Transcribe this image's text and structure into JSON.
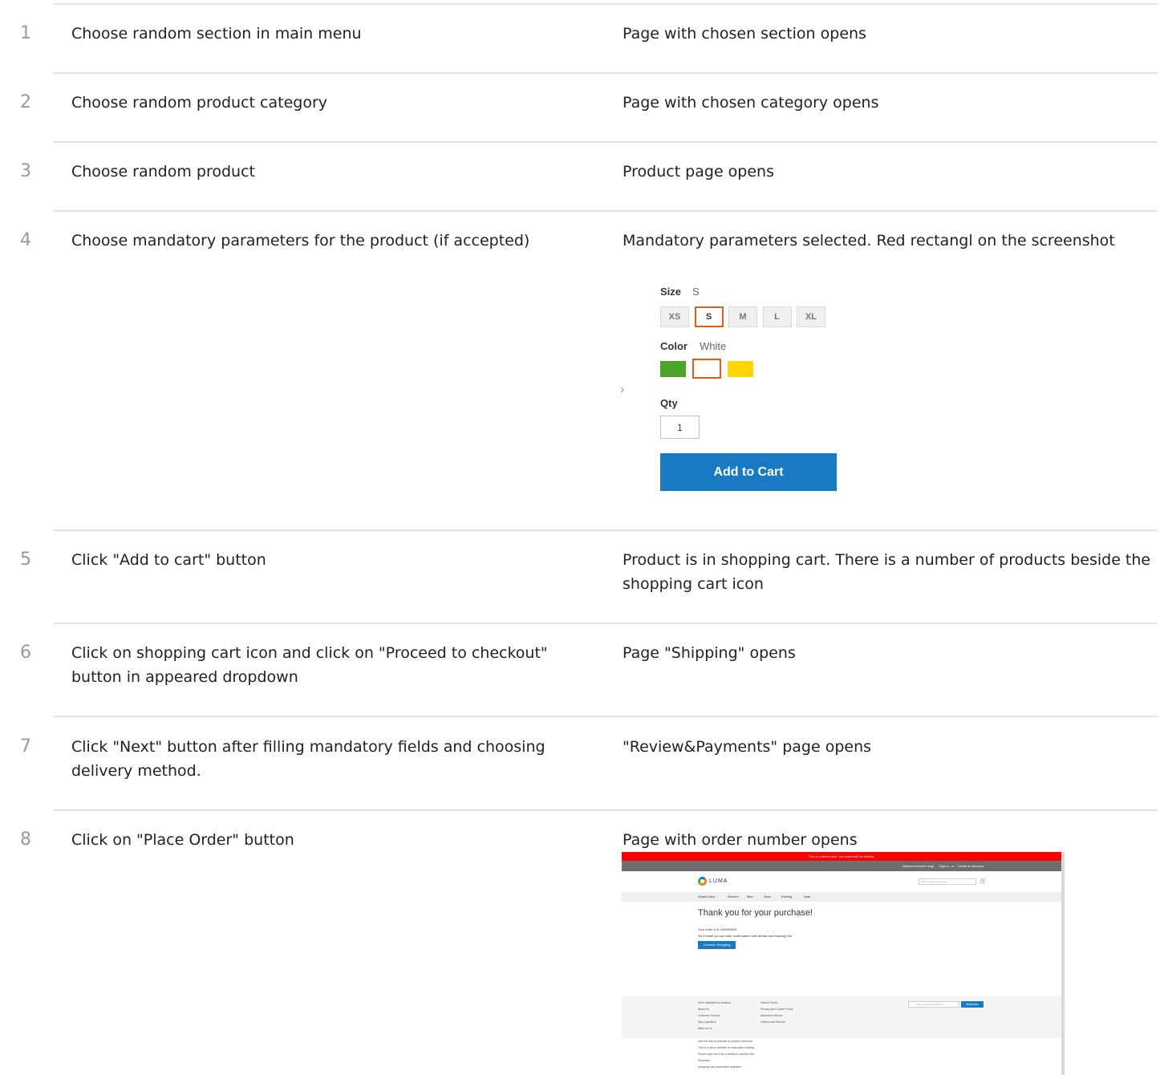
{
  "steps": [
    {
      "num": "1",
      "action": "Choose random section in main menu",
      "result": "Page with chosen section opens"
    },
    {
      "num": "2",
      "action": "Choose random product category",
      "result": "Page with chosen category opens"
    },
    {
      "num": "3",
      "action": "Choose random product",
      "result": "Product page opens"
    },
    {
      "num": "4",
      "action": "Choose mandatory parameters for the product (if accepted)",
      "result": "Mandatory parameters selected. Red rectangl on the screenshot"
    },
    {
      "num": "5",
      "action": "Click \"Add to cart\" button",
      "result": "Product is in shopping cart. There is a number of products beside the shopping cart icon"
    },
    {
      "num": "6",
      "action": "Click on shopping cart icon and click on \"Proceed to checkout\" button in appeared dropdown",
      "result": "Page \"Shipping\" opens"
    },
    {
      "num": "7",
      "action": "Click \"Next\" button after filling mandatory fields and choosing delivery method.",
      "result": "\"Review&Payments\" page opens"
    },
    {
      "num": "8",
      "action": "Click on \"Place Order\" button",
      "result": "Page with order number opens"
    }
  ],
  "product_options": {
    "size_label": "Size",
    "size_value": "S",
    "sizes": [
      "XS",
      "S",
      "M",
      "L",
      "XL"
    ],
    "selected_size": "S",
    "color_label": "Color",
    "color_value": "White",
    "colors": [
      "#4ca52a",
      "#ffffff",
      "#ffd500"
    ],
    "qty_label": "Qty",
    "qty_value": "1",
    "add_to_cart": "Add to Cart",
    "highlight_color": "#e55a1b"
  },
  "order_page": {
    "demo_notice": "This is a demo store. No orders will be fulfilled.",
    "welcome": "Default welcome msg!",
    "sign_in": "Sign In",
    "or": "or",
    "create_account": "Create an Account",
    "logo": "LUMA",
    "search_placeholder": "Search entire store here...",
    "nav": [
      "What's New",
      "Women",
      "Men",
      "Gear",
      "Training",
      "Sale"
    ],
    "thanks": "Thank you for your purchase!",
    "order_line": "Your order # is: 000009820.",
    "email_line": "We'll email you an order confirmation with details and tracking info.",
    "continue": "Continue Shopping",
    "footer_col1": [
      "More websites for practice",
      "About us",
      "Customer Service",
      "Ask a question",
      "Write for us"
    ],
    "footer_col2": [
      "Search Terms",
      "Privacy and Cookie Policy",
      "Advanced Search",
      "Orders and Returns"
    ],
    "email_placeholder": "Enter your email address",
    "subscribe": "Subscribe",
    "bottom_lines": [
      "Use this site to website to practice selenium.",
      "This is a demo website for automation testing.",
      "People also use it as a selenium practice site.",
      "Searches:",
      "shopping cart automation selenium"
    ]
  }
}
